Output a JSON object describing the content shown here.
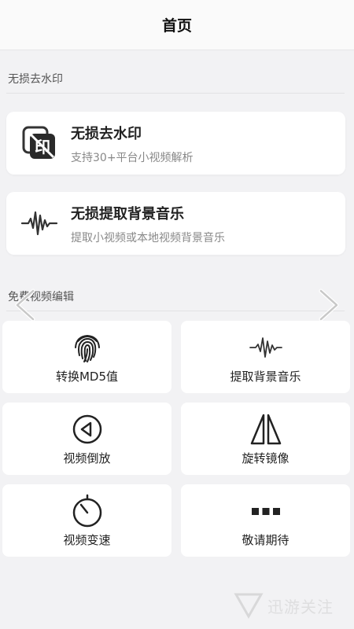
{
  "header": {
    "title": "首页"
  },
  "section1": {
    "title": "无损去水印"
  },
  "cards": [
    {
      "title": "无损去水印",
      "desc": "支持30+平台小视频解析",
      "icon": "watermark-remove-icon"
    },
    {
      "title": "无损提取背景音乐",
      "desc": "提取小视频或本地视频背景音乐",
      "icon": "waveform-icon"
    }
  ],
  "section2": {
    "title": "免费视频编辑"
  },
  "tiles": [
    {
      "label": "转换MD5值",
      "icon": "fingerprint-icon"
    },
    {
      "label": "提取背景音乐",
      "icon": "waveform-icon"
    },
    {
      "label": "视频倒放",
      "icon": "reverse-play-icon"
    },
    {
      "label": "旋转镜像",
      "icon": "mirror-icon"
    },
    {
      "label": "视频变速",
      "icon": "timer-icon"
    },
    {
      "label": "敬请期待",
      "icon": "more-icon"
    }
  ],
  "watermark": {
    "text": "迅游关注"
  },
  "colors": {
    "background": "#f2f2f4",
    "card": "#ffffff",
    "text": "#222222",
    "muted": "#888888"
  }
}
